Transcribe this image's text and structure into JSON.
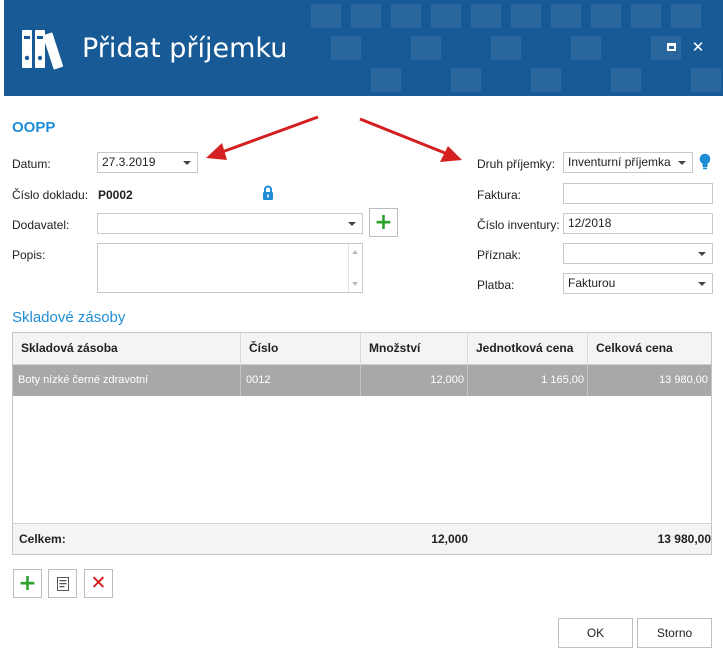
{
  "window": {
    "title": "Přidat příjemku",
    "icon": "binders-icon",
    "title_bar_color": "#175a96"
  },
  "form": {
    "section_title": "OOPP",
    "datum": {
      "label": "Datum:",
      "value": "27.3.2019"
    },
    "cislo_dokladu": {
      "label": "Číslo dokladu:",
      "value": "P0002"
    },
    "dodavatel": {
      "label": "Dodavatel:",
      "value": ""
    },
    "popis": {
      "label": "Popis:",
      "value": ""
    },
    "druh_prijemky": {
      "label": "Druh příjemky:",
      "value": "Inventurní příjemka"
    },
    "faktura": {
      "label": "Faktura:",
      "value": ""
    },
    "cislo_inventury": {
      "label": "Číslo inventury:",
      "value": "12/2018"
    },
    "priznak": {
      "label": "Příznak:",
      "value": ""
    },
    "platba": {
      "label": "Platba:",
      "value": "Fakturou"
    }
  },
  "stock": {
    "section_title": "Skladové zásoby",
    "columns": [
      "Skladová zásoba",
      "Číslo",
      "Množství",
      "Jednotková cena",
      "Celková cena"
    ],
    "rows": [
      [
        "Boty nízké černé zdravotní",
        "0012",
        "12,000",
        "1 165,00",
        "13 980,00"
      ]
    ],
    "footer": {
      "label": "Celkem:",
      "quantity": "12,000",
      "total": "13 980,00"
    },
    "selected_row_color": "#a8a8a8"
  },
  "buttons": {
    "ok": "OK",
    "cancel": "Storno"
  },
  "colors": {
    "accent": "#1f8dd6",
    "add": "#2fa12f",
    "delete": "#d11818",
    "arrow": "#d42020"
  }
}
